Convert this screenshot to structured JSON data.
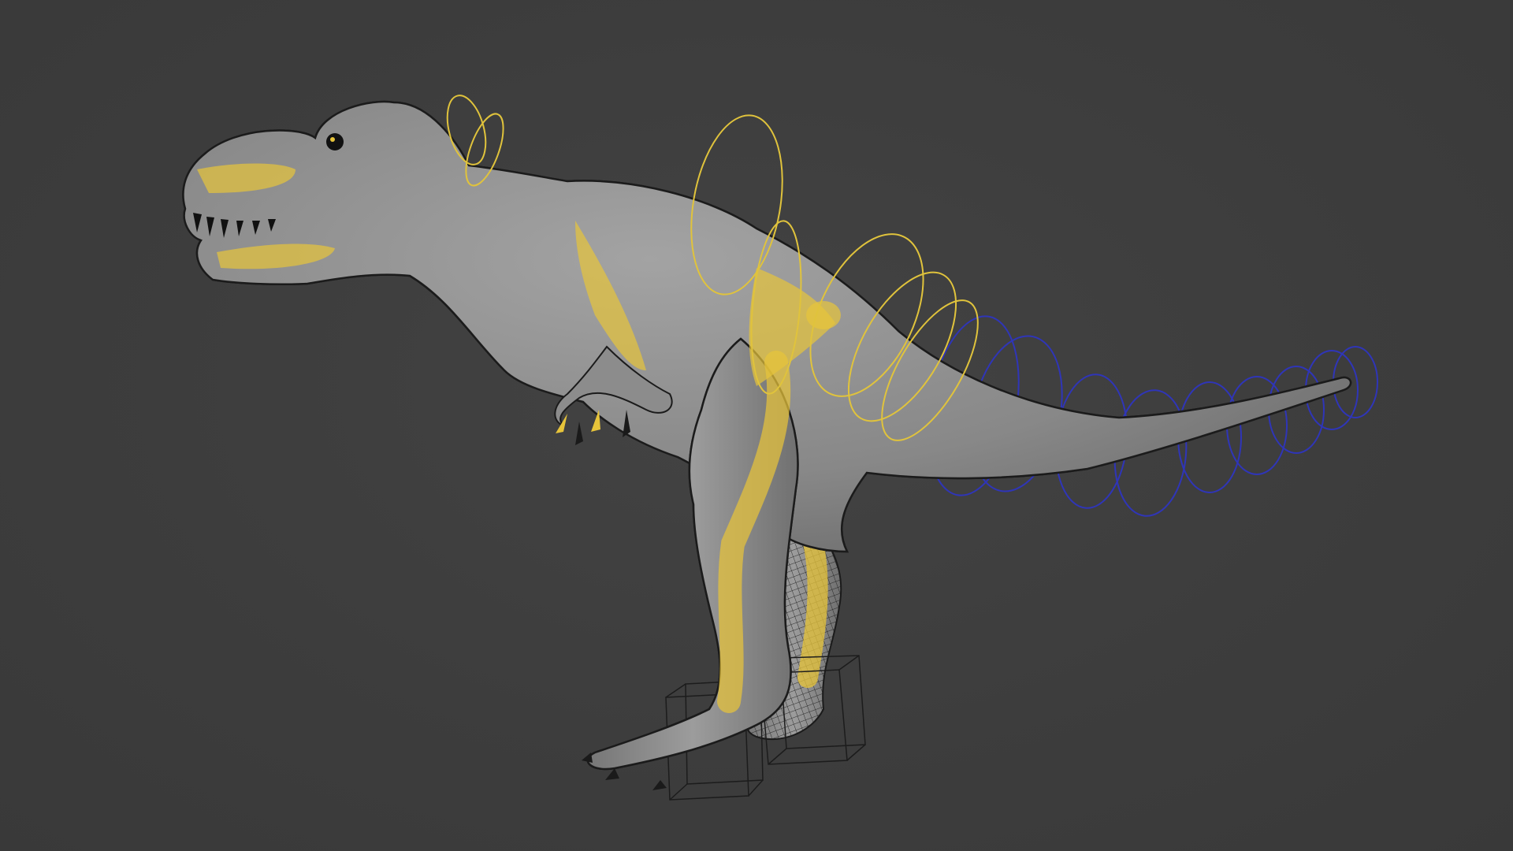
{
  "viewport": {
    "background": "#3d3d3d",
    "subject": "t-rex-rig",
    "mesh_fill": "#8e8e8e",
    "wire_color": "#1b1b1b",
    "highlight_color": "#e7c43a",
    "fk_control_color": "#e0c33c",
    "tail_control_color": "#2f35b8",
    "ik_box_color": "#1c1c1c"
  }
}
